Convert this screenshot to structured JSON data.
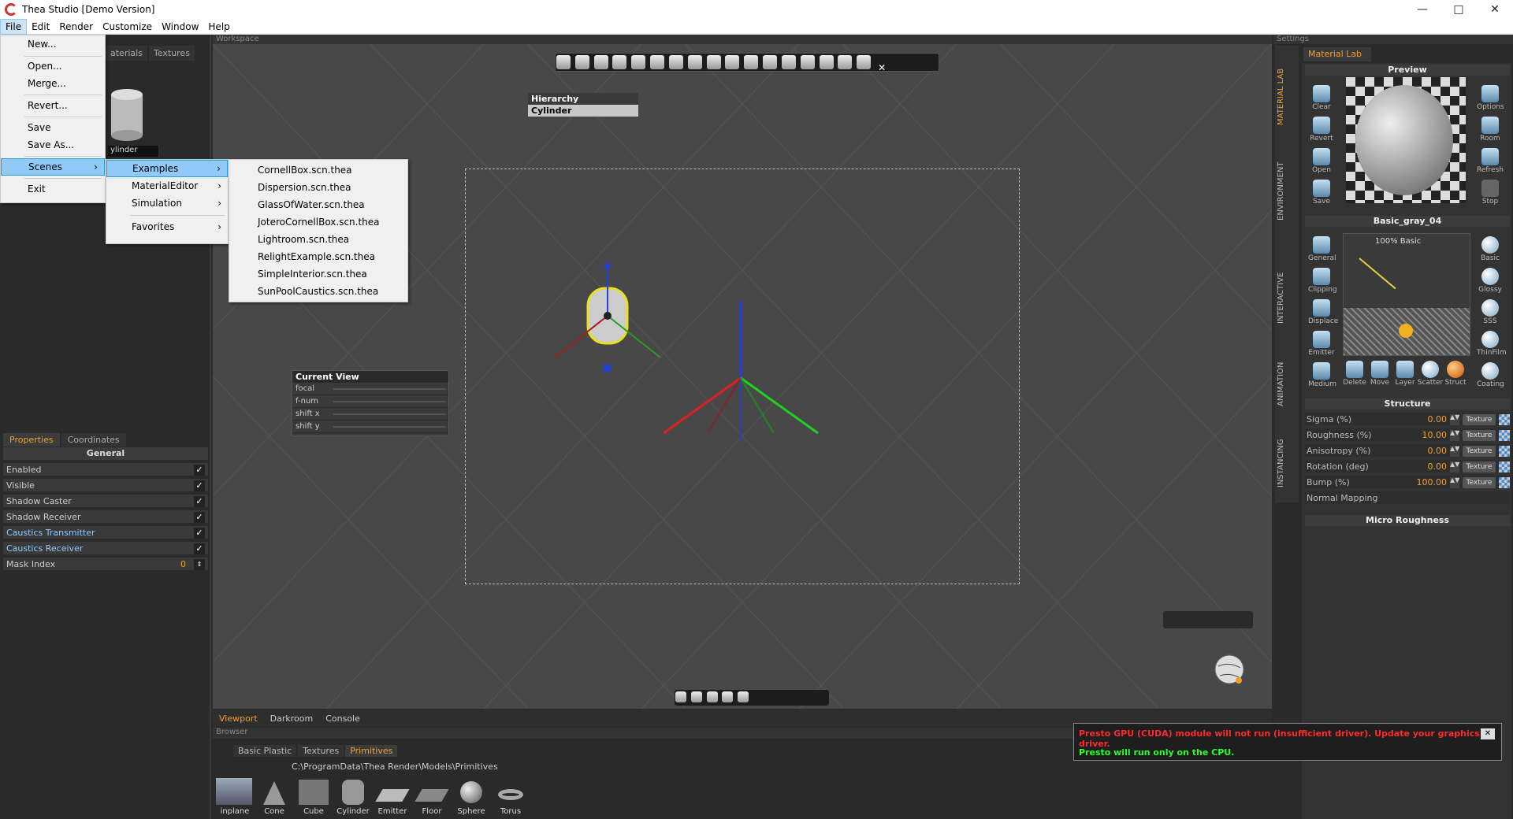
{
  "window": {
    "title": "Thea Studio [Demo Version]",
    "minimize": "—",
    "maximize": "□",
    "close": "✕"
  },
  "menubar": [
    "File",
    "Edit",
    "Render",
    "Customize",
    "Window",
    "Help"
  ],
  "file_menu": {
    "items": [
      "New...",
      "Open...",
      "Merge...",
      "Revert...",
      "Save",
      "Save As...",
      "Scenes",
      "Exit"
    ]
  },
  "scenes_menu": {
    "items": [
      "Examples",
      "MaterialEditor",
      "Simulation",
      "Favorites"
    ]
  },
  "examples_menu": {
    "items": [
      "CornellBox.scn.thea",
      "Dispersion.scn.thea",
      "GlassOfWater.scn.thea",
      "JoteroCornellBox.scn.thea",
      "Lightroom.scn.thea",
      "RelightExample.scn.thea",
      "SimpleInterior.scn.thea",
      "SunPoolCaustics.scn.thea"
    ]
  },
  "left_panel": {
    "tabs": [
      "aterials",
      "Textures"
    ],
    "selected_object_label": "ylinder",
    "props_tabs": [
      "Properties",
      "Coordinates"
    ],
    "section": "General",
    "rows": [
      {
        "label": "Enabled",
        "checked": true,
        "highlight": false
      },
      {
        "label": "Visible",
        "checked": true,
        "highlight": false
      },
      {
        "label": "Shadow Caster",
        "checked": true,
        "highlight": false
      },
      {
        "label": "Shadow Receiver",
        "checked": true,
        "highlight": false
      },
      {
        "label": "Caustics Transmitter",
        "checked": true,
        "highlight": true
      },
      {
        "label": "Caustics Receiver",
        "checked": true,
        "highlight": true
      }
    ],
    "mask_index": {
      "label": "Mask Index",
      "value": "0"
    }
  },
  "workspace": {
    "header": "Workspace",
    "hierarchy": {
      "title": "Hierarchy",
      "item": "Cylinder"
    },
    "current_view": {
      "title": "Current View",
      "rows": [
        "focal",
        "f-num",
        "shift x",
        "shift y"
      ]
    },
    "view_tabs": [
      "Viewport",
      "Darkroom",
      "Console"
    ]
  },
  "browser": {
    "header": "Browser",
    "tabs": [
      "Basic Plastic",
      "Textures",
      "Primitives"
    ],
    "path": "C:\\ProgramData\\Thea Render\\Models\\Primitives",
    "items": [
      "inplane",
      "Cone",
      "Cube",
      "Cylinder",
      "Emitter",
      "Floor",
      "Sphere",
      "Torus"
    ]
  },
  "settings": {
    "header": "Settings",
    "vertical_tabs": [
      "MATERIAL LAB",
      "ENVIRONMENT",
      "INTERACTIVE",
      "ANIMATION",
      "INSTANCING"
    ],
    "material_lab_tab": "Material Lab",
    "preview_title": "Preview",
    "preview_left_buttons": [
      "Clear",
      "Revert",
      "Open",
      "Save"
    ],
    "preview_right_buttons": [
      "Options",
      "Room",
      "Refresh",
      "Stop"
    ],
    "material_name": "Basic_gray_04",
    "layer_label": "100% Basic",
    "left_buttons": [
      "General",
      "Clipping",
      "Displace",
      "Emitter",
      "Medium"
    ],
    "right_buttons": [
      "Basic",
      "Glossy",
      "SSS",
      "ThinFilm",
      "Coating"
    ],
    "bottom_buttons": [
      "Delete",
      "Move",
      "Layer",
      "Scatter",
      "Struct"
    ],
    "structure_title": "Structure",
    "structure_rows": [
      {
        "label": "Sigma (%)",
        "value": "0.00",
        "texture": "Texture"
      },
      {
        "label": "Roughness (%)",
        "value": "10.00",
        "texture": "Texture"
      },
      {
        "label": "Anisotropy (%)",
        "value": "0.00",
        "texture": "Texture"
      },
      {
        "label": "Rotation (deg)",
        "value": "0.00",
        "texture": "Texture"
      },
      {
        "label": "Bump (%)",
        "value": "100.00",
        "texture": "Texture"
      }
    ],
    "normal_mapping": "Normal Mapping",
    "micro_roughness": "Micro Roughness"
  },
  "warning": {
    "line1": "Presto GPU (CUDA) module will not run (insufficient driver). Update your graphics driver.",
    "line2": "Presto will run only on the CPU.",
    "close": "✕"
  },
  "colors": {
    "accent": "#f0a030",
    "axis_x": "#e02020",
    "axis_y": "#20d020",
    "axis_z": "#2040e0"
  }
}
